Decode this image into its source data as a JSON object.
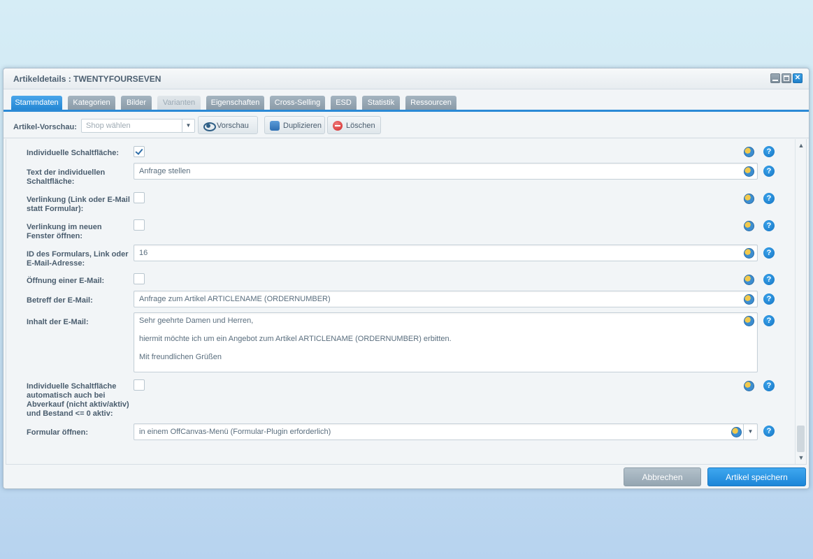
{
  "window": {
    "title": "Artikeldetails : TWENTYFOURSEVEN",
    "controls": [
      "minimize-icon",
      "maximize-icon",
      "close-icon"
    ]
  },
  "tabs": [
    {
      "label": "Stammdaten",
      "state": "active"
    },
    {
      "label": "Kategorien",
      "state": "normal"
    },
    {
      "label": "Bilder",
      "state": "normal"
    },
    {
      "label": "Varianten",
      "state": "disabled"
    },
    {
      "label": "Eigenschaften",
      "state": "normal"
    },
    {
      "label": "Cross-Selling",
      "state": "normal"
    },
    {
      "label": "ESD",
      "state": "normal"
    },
    {
      "label": "Statistik",
      "state": "normal"
    },
    {
      "label": "Ressourcen",
      "state": "normal"
    }
  ],
  "toolbar": {
    "preview_label": "Artikel-Vorschau:",
    "shop_placeholder": "Shop wählen",
    "preview_button": "Vorschau",
    "duplicate_button": "Duplizieren",
    "delete_button": "Löschen"
  },
  "form": {
    "individual_button": {
      "label": "Individuelle Schaltfläche:",
      "checked": true
    },
    "button_text": {
      "label": "Text der individuellen Schaltfläche:",
      "value": "Anfrage stellen"
    },
    "link_instead": {
      "label": "Verlinkung (Link oder E-Mail statt Formular):",
      "checked": false
    },
    "new_window": {
      "label": "Verlinkung im neuen Fenster öffnen:",
      "checked": false
    },
    "form_id": {
      "label": "ID des Formulars, Link oder E-Mail-Adresse:",
      "value": "16"
    },
    "open_email": {
      "label": "Öffnung einer E-Mail:",
      "checked": false
    },
    "email_subject": {
      "label": "Betreff der E-Mail:",
      "value": "Anfrage zum Artikel ARTICLENAME (ORDERNUMBER)"
    },
    "email_body": {
      "label": "Inhalt der E-Mail:",
      "line1": "Sehr geehrte Damen und Herren,",
      "line2": "hiermit möchte ich um ein Angebot zum Artikel ARTICLENAME (ORDERNUMBER) erbitten.",
      "line3": "Mit freundlichen Grüßen"
    },
    "auto_button": {
      "label": "Individuelle Schaltfläche automatisch auch bei Abverkauf (nicht aktiv/aktiv) und Bestand <= 0 aktiv:",
      "checked": false
    },
    "open_form": {
      "label": "Formular öffnen:",
      "value": "in einem OffCanvas-Menü (Formular-Plugin erforderlich)"
    }
  },
  "footer": {
    "cancel_button": "Abbrechen",
    "save_button": "Artikel speichern"
  },
  "colors": {
    "accent": "#2487d4",
    "tab_inactive": "#8b9ba8"
  }
}
